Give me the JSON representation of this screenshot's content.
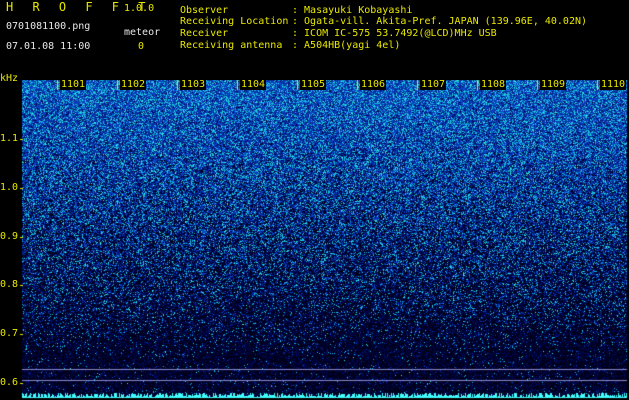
{
  "header": {
    "app_title": "H R O F F T",
    "version": "1.0.0",
    "filename": "0701081100.png",
    "datetime": "07.01.08 11:00",
    "meteor_label": "meteor",
    "meteor_count": "0",
    "observer_label": "Observer",
    "observer_value": ": Masayuki Kobayashi",
    "location_label": "Receiving Location",
    "location_value": ": Ogata-vill. Akita-Pref. JAPAN (139.96E, 40.02N)",
    "receiver_label": "Receiver",
    "receiver_value": ": ICOM IC-575 53.7492(@LCD)MHz USB",
    "antenna_label": "Receiving antenna",
    "antenna_value": ": A504HB(yagi 4el)"
  },
  "chart_data": {
    "type": "heatmap",
    "ylabel": "kHz",
    "y_ticks": [
      "1.1",
      "1.0",
      "0.9",
      "0.8",
      "0.7",
      "0.6"
    ],
    "x_ticks": [
      "1101",
      "1102",
      "1103",
      "1104",
      "1105",
      "1106",
      "1107",
      "1108",
      "1109",
      "1110"
    ],
    "ylim": [
      0.57,
      1.22
    ],
    "colors": {
      "low": "#000020",
      "mid": "#1030c0",
      "high": "#30ffff",
      "text": "#e8e800"
    }
  }
}
